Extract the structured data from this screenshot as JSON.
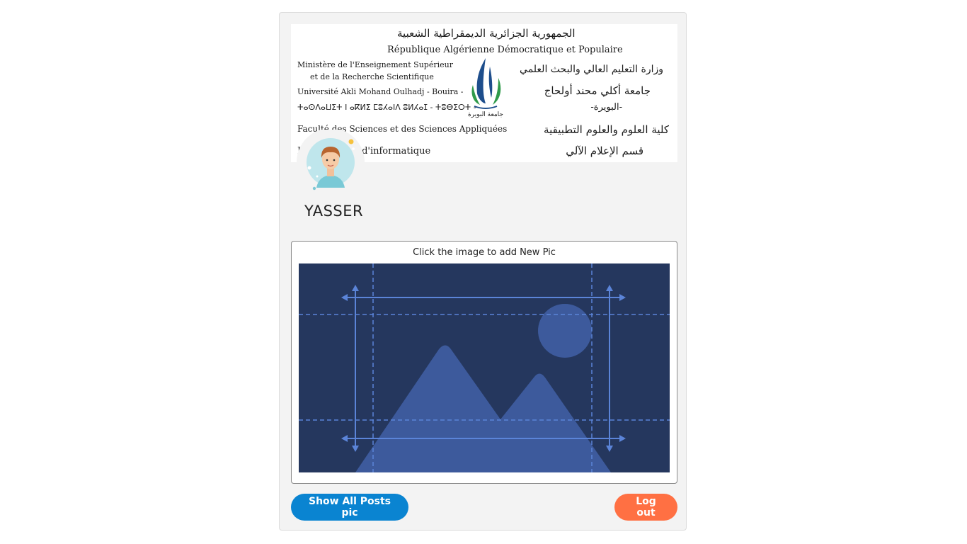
{
  "banner": {
    "line_ar_top": "الجمهورية الجزائرية الديمقراطية الشعبية",
    "line_fr_top": "République Algérienne Démocratique et Populaire",
    "fr_ministry_1": "Ministère de l'Enseignement Supérieur",
    "fr_ministry_2": "et de la Recherche Scientifique",
    "fr_university": "Université Akli Mohand Oulhadj - Bouira -",
    "tifinagh": "ⵜⴰⵙⴷⴰⵡⵉⵜ ⵏ ⴰⴽⵍⵉ ⵎⵓⵃⴰⵏⴷ ⵓⵍⵃⴰⵊ - ⵜⵓⴱⵉⵔⵜ -",
    "fr_faculty": "Faculté des Sciences et des Sciences Appliquées",
    "fr_department": "Département d'informatique",
    "ar_ministry": "وزارة التعليم العالي والبحث العلمي",
    "ar_university": "جامعة أكلي محند أولحاج",
    "ar_city": "-البويرة-",
    "ar_faculty": "كلية العلوم والعلوم التطبيقية",
    "ar_department": "قسم الإعلام الآلي",
    "logo_caption": "جامعة البويرة"
  },
  "profile": {
    "username": "YASSER"
  },
  "upload": {
    "caption": "Click the image to add New Pic"
  },
  "buttons": {
    "show_posts": "Show All Posts pic",
    "logout": "Log out"
  },
  "colors": {
    "primary": "#0a84d1",
    "danger": "#ff7043",
    "placeholder_bg": "#25375e",
    "placeholder_shape": "#3d5a9c",
    "placeholder_line": "#5b84d8"
  }
}
